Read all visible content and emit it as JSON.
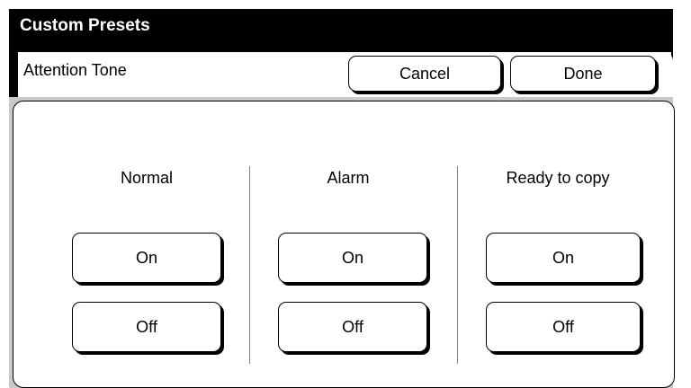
{
  "title": "Custom Presets",
  "header": {
    "subtitle": "Attention Tone",
    "cancel_label": "Cancel",
    "done_label": "Done"
  },
  "columns": [
    {
      "label": "Normal",
      "on_label": "On",
      "off_label": "Off"
    },
    {
      "label": "Alarm",
      "on_label": "On",
      "off_label": "Off"
    },
    {
      "label": "Ready to copy",
      "on_label": "On",
      "off_label": "Off"
    }
  ],
  "colors": {
    "frame": "#000000",
    "panel_border": "#c9c9c9",
    "background": "#ffffff"
  }
}
